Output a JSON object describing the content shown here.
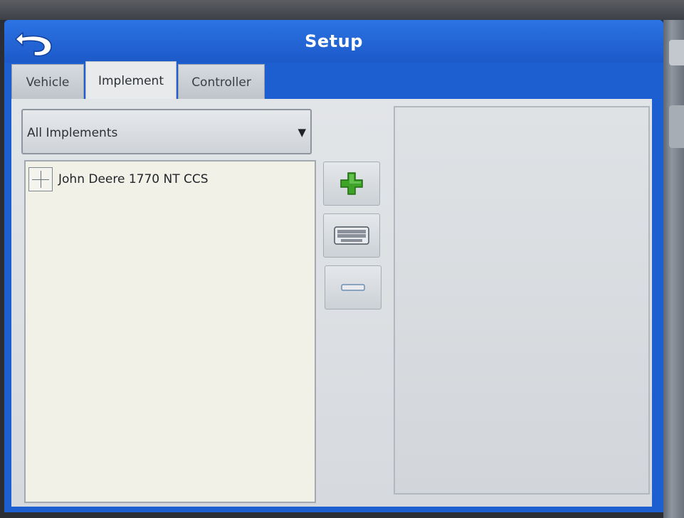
{
  "window": {
    "title": "Setup"
  },
  "tabs": [
    {
      "label": "Vehicle",
      "active": false
    },
    {
      "label": "Implement",
      "active": true
    },
    {
      "label": "Controller",
      "active": false
    }
  ],
  "filter": {
    "selected": "All Implements",
    "arrow": "▼"
  },
  "implements": [
    {
      "label": "John Deere 1770 NT CCS",
      "expanded": false
    }
  ],
  "actions": {
    "add_icon": "plus-icon",
    "edit_icon": "keyboard-icon",
    "remove_icon": "minus-icon"
  },
  "colors": {
    "titlebar": "#1d5fd0",
    "add_icon": "#3ea428",
    "panel": "#d6dade"
  }
}
